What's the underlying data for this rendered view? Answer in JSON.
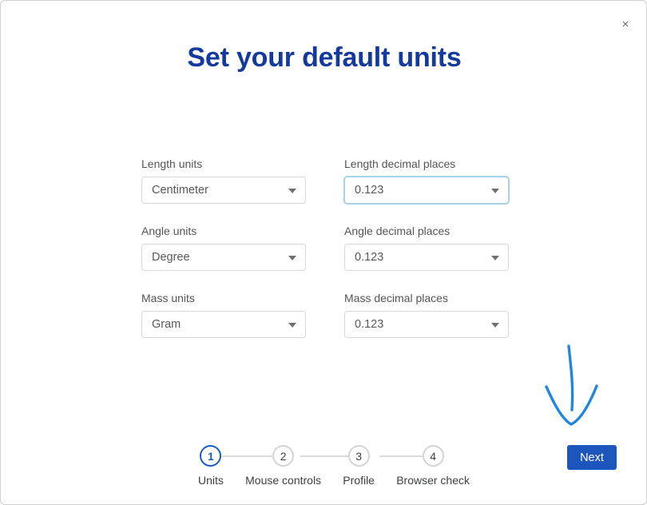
{
  "dialog": {
    "title": "Set your default units",
    "close_label": "×",
    "close_icon": "close-icon"
  },
  "colors": {
    "title_blue": "#153a9e",
    "primary_blue": "#1c56bd",
    "focus_border": "#a6d2ea",
    "annotation_blue": "#2187dd",
    "label_gray": "#555555",
    "border_gray": "#d6d9db"
  },
  "form": {
    "rows": [
      {
        "left": {
          "label": "Length units",
          "value": "Centimeter",
          "focused": false,
          "icon": "chevron-down-icon"
        },
        "right": {
          "label": "Length decimal places",
          "value": "0.123",
          "focused": true,
          "icon": "chevron-down-icon"
        }
      },
      {
        "left": {
          "label": "Angle units",
          "value": "Degree",
          "focused": false,
          "icon": "chevron-down-icon"
        },
        "right": {
          "label": "Angle decimal places",
          "value": "0.123",
          "focused": false,
          "icon": "chevron-down-icon"
        }
      },
      {
        "left": {
          "label": "Mass units",
          "value": "Gram",
          "focused": false,
          "icon": "chevron-down-icon"
        },
        "right": {
          "label": "Mass decimal places",
          "value": "0.123",
          "focused": false,
          "icon": "chevron-down-icon"
        }
      }
    ]
  },
  "stepper": {
    "current_step": 1,
    "steps": [
      {
        "number": "1",
        "label": "Units"
      },
      {
        "number": "2",
        "label": "Mouse controls"
      },
      {
        "number": "3",
        "label": "Profile"
      },
      {
        "number": "4",
        "label": "Browser check"
      }
    ]
  },
  "footer": {
    "next_label": "Next"
  },
  "annotation": {
    "type": "hand-drawn-arrow",
    "direction": "down",
    "points_to": "Next"
  }
}
